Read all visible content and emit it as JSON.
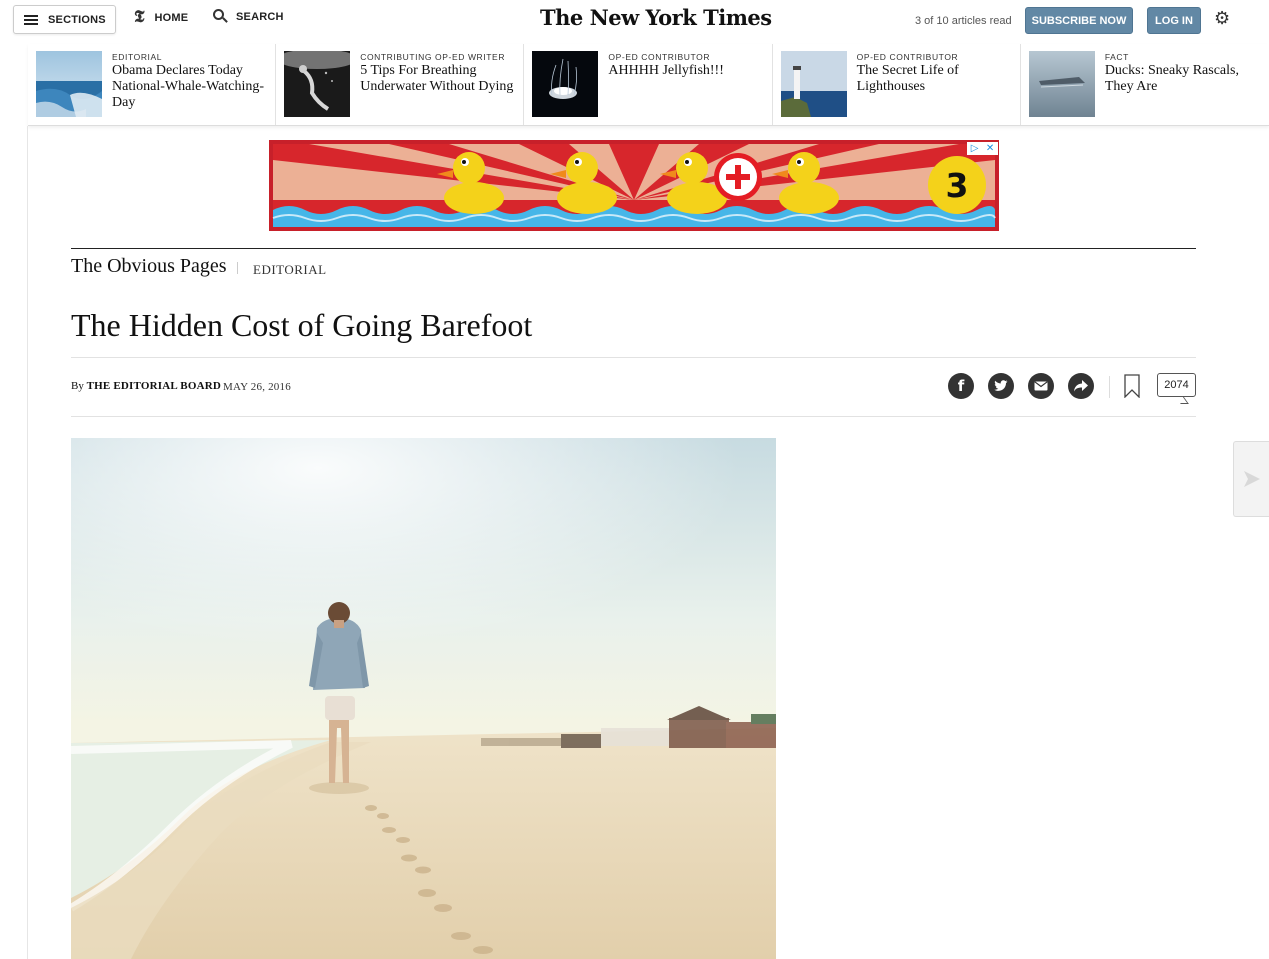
{
  "topbar": {
    "sections_label": "SECTIONS",
    "home_label": "HOME",
    "search_label": "SEARCH",
    "t_logo": "𝕿",
    "masthead": "The New York Times",
    "articles_read": "3 of 10 articles read",
    "subscribe_label": "SUBSCRIBE NOW",
    "login_label": "LOG IN"
  },
  "ribbon": {
    "items": [
      {
        "kicker": "EDITORIAL",
        "title": "Obama Declares Today National-Whale-Watching-Day",
        "thumb": "ocean-coast"
      },
      {
        "kicker": "CONTRIBUTING OP-ED WRITER",
        "title": "5 Tips For Breathing Underwater Without Dying",
        "thumb": "underwater-diver"
      },
      {
        "kicker": "OP-ED CONTRIBUTOR",
        "title": "AHHHH Jellyfish!!!",
        "thumb": "jellyfish"
      },
      {
        "kicker": "OP-ED CONTRIBUTOR",
        "title": "The Secret Life of Lighthouses",
        "thumb": "lighthouse"
      },
      {
        "kicker": "FACT",
        "title": "Ducks: Sneaky Rascals, They Are",
        "thumb": "ducks-water"
      }
    ]
  },
  "ad": {
    "counter": "3",
    "choices_icon": "ad-choices-icon"
  },
  "article": {
    "column": "The Obvious Pages",
    "kicker": "EDITORIAL",
    "headline": "The Hidden Cost of Going Barefoot",
    "byline_prefix": "By",
    "byline_author": "THE EDITORIAL BOARD",
    "date": "MAY 26, 2016",
    "comment_count": "2074",
    "hero_image": "woman-walking-barefoot-on-beach"
  },
  "colors": {
    "accent_blue": "#6288a5",
    "ad_red": "#d7262c",
    "duck_yellow": "#f4d21a"
  }
}
